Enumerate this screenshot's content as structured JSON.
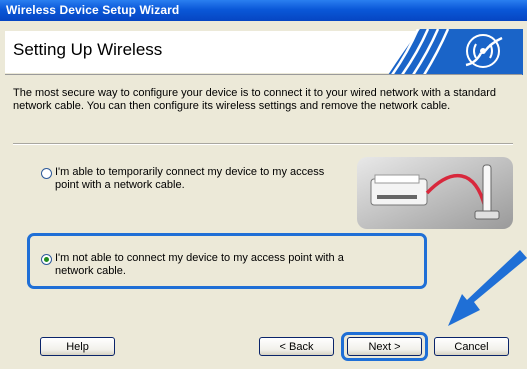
{
  "window": {
    "title": "Wireless Device Setup Wizard"
  },
  "header": {
    "title": "Setting Up Wireless"
  },
  "intro": "The most secure way to configure your device is to connect it to your wired network with a standard network cable. You can then configure its wireless settings and remove the network cable.",
  "options": [
    {
      "label": "I'm able to temporarily connect my device to my access point with a network cable.",
      "checked": false
    },
    {
      "label": "I'm not able to connect my device to my access point with a network cable.",
      "checked": true
    }
  ],
  "buttons": {
    "help": "Help",
    "back": "< Back",
    "next": "Next >",
    "cancel": "Cancel"
  },
  "colors": {
    "title_bar": "#0a58d8",
    "highlight": "#1f6fd6",
    "dialog_bg": "#ece9d8",
    "logo_blue": "#1a64c8",
    "cable_red": "#d8283c"
  },
  "icons": {
    "logo": "wireless-signal-logo",
    "illustration": "printer-cable-access-point",
    "pointer": "blue-arrow"
  }
}
